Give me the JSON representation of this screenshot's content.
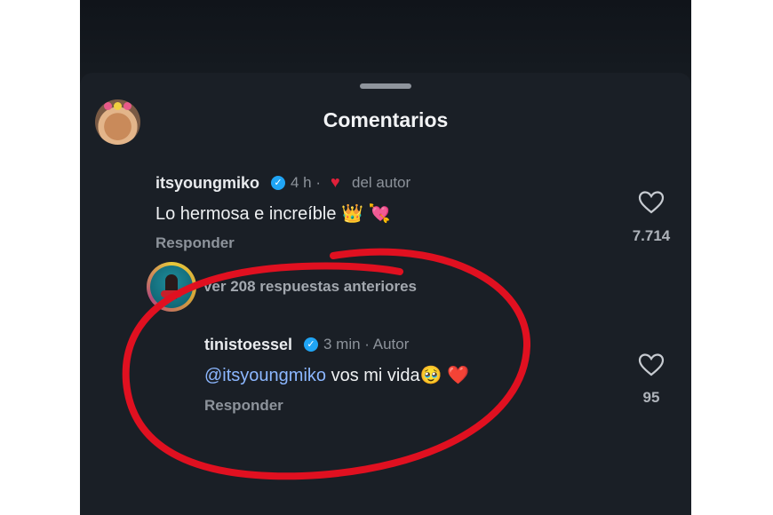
{
  "sheet": {
    "title": "Comentarios"
  },
  "comments": [
    {
      "username": "itsyoungmiko",
      "time": "4 h ·",
      "badge": "del autor",
      "text": "Lo hermosa e increíble",
      "emojis": "👑 💘",
      "reply_label": "Responder",
      "likes": "7.714"
    },
    {
      "username": "tinistoessel",
      "time": "3 min · Autor",
      "mention": "@itsyoungmiko",
      "text": "vos mi vida",
      "emojis": "🥹 ❤️",
      "reply_label": "Responder",
      "likes": "95"
    }
  ],
  "replies_link": "Ver 208 respuestas anteriores",
  "colors": {
    "background": "#1a1f26",
    "verified": "#20a5f5",
    "highlight_circle": "#e01020",
    "mention": "#8cb7ff"
  },
  "icons": [
    "verified-badge-icon",
    "heart-outline-icon",
    "heart-icon"
  ]
}
